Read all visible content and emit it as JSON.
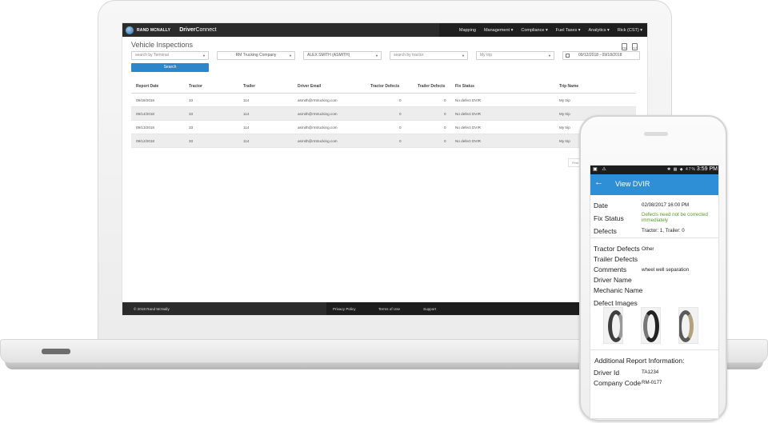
{
  "laptop": {
    "brand": {
      "logo_text": "RAND MCNALLY",
      "product_bold": "Driver",
      "product_rest": "Connect"
    },
    "nav": [
      "Mapping",
      "Management ▾",
      "Compliance ▾",
      "Fuel Taxes ▾",
      "Analytics ▾",
      "Rick (CST) ▾"
    ],
    "page_title": "Vehicle Inspections",
    "exports": [
      "pdf-icon",
      "excel-icon"
    ],
    "filters": {
      "terminal_placeholder": "search by Terminal",
      "company": "RM Trucking Company",
      "driver": "ALEX SMITH (ASMITH)",
      "tractor_placeholder": "search by tractor",
      "trip_placeholder": "My trip",
      "date_range": "09/12/2018 - 09/18/2018"
    },
    "search_label": "Search",
    "table": {
      "headers": [
        "Report Date",
        "Tractor",
        "Trailer",
        "Driver Email",
        "Tractor Defects",
        "Trailer Defects",
        "Fix Status",
        "Trip Name"
      ],
      "rows": [
        [
          "09/18/2018",
          "33",
          "114",
          "asmith@rmtrucking.com",
          "0",
          "0",
          "No defect DVIR",
          "My trip"
        ],
        [
          "09/14/2018",
          "33",
          "114",
          "asmith@rmtrucking.com",
          "0",
          "0",
          "No defect DVIR",
          "My trip"
        ],
        [
          "09/13/2018",
          "33",
          "114",
          "asmith@rmtrucking.com",
          "0",
          "0",
          "No defect DVIR",
          "My trip"
        ],
        [
          "09/12/2018",
          "33",
          "114",
          "asmith@rmtrucking.com",
          "0",
          "0",
          "No defect DVIR",
          "My trip"
        ]
      ]
    },
    "pager_label": "First",
    "footer": {
      "copyright": "© 2018 Rand McNally",
      "links": [
        "Privacy Policy",
        "Terms of Use",
        "Support"
      ]
    }
  },
  "phone": {
    "status": {
      "battery": "47%",
      "time": "3:59 PM"
    },
    "app_title": "View DVIR",
    "fields": {
      "date_label": "Date",
      "date_value": "02/08/2017 16:00 PM",
      "fix_status_label": "Fix Status",
      "fix_status_value": "Defects need not be corrected immediately",
      "defects_label": "Defects",
      "defects_value": "Tractor: 1, Trailer: 0",
      "tractor_defects_label": "Tractor Defects",
      "tractor_defects_value": "Other",
      "trailer_defects_label": "Trailer Defects",
      "comments_label": "Comments",
      "comments_value": "wheel well separation",
      "driver_name_label": "Driver Name",
      "mechanic_name_label": "Mechanic Name",
      "defect_images_label": "Defect Images",
      "additional_label": "Additional Report Information:",
      "driver_id_label": "Driver Id",
      "driver_id_value": "TA1234",
      "company_code_label": "Company Code",
      "company_code_value": "RM-0177"
    }
  }
}
